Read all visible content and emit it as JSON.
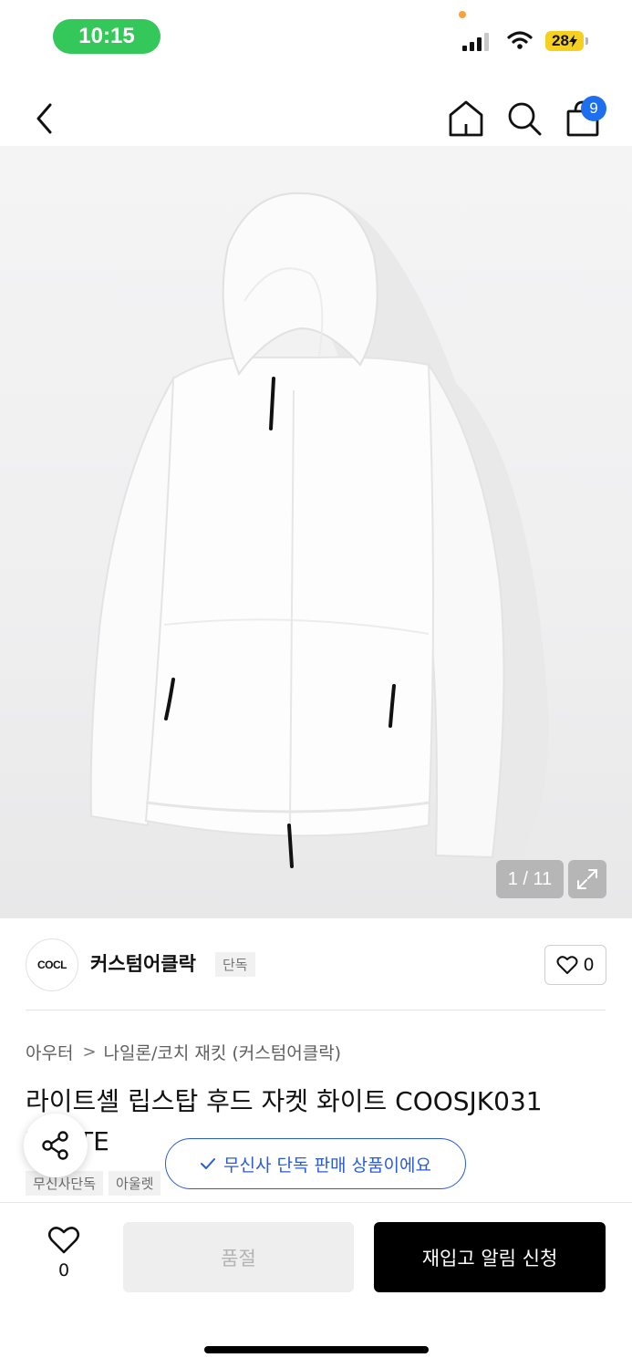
{
  "status_bar": {
    "time": "10:15",
    "battery": "28",
    "colors": {
      "time_pill": "#34c759",
      "battery": "#f5d020",
      "dot": "#f7a23b"
    }
  },
  "nav": {
    "back_icon": "chevron-left-icon",
    "home_icon": "home-icon",
    "search_icon": "search-icon",
    "cart_icon": "shopping-bag-icon",
    "cart_count": "9"
  },
  "gallery": {
    "counter": "1 / 11",
    "expand_icon": "expand-icon"
  },
  "brand": {
    "logo_text": "COCL",
    "name": "커스텀어클락",
    "tag": "단독",
    "like_count": "0"
  },
  "breadcrumb": {
    "items": [
      "아우터",
      "나일론/코치 재킷 (커스텀어클락)"
    ]
  },
  "product": {
    "title": "라이트셸 립스탑 후드 자켓 화이트 COOSJK031 WHITE",
    "tags": [
      "무신사단독",
      "아울렛"
    ]
  },
  "toast": {
    "message": "무신사 단독 판매 상품이에요",
    "color": "#2a5bd7"
  },
  "bottom_bar": {
    "like_count": "0",
    "sold_out_label": "품절",
    "restock_label": "재입고 알림 신청"
  }
}
